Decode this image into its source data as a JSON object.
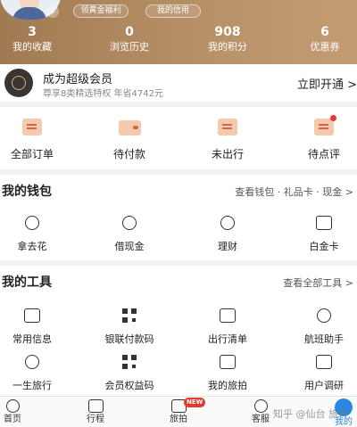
{
  "header": {
    "benefit_pill": "领黄金福利",
    "credit_pill": "我的信用",
    "stats": [
      {
        "value": "3",
        "label": "我的收藏"
      },
      {
        "value": "0",
        "label": "浏览历史"
      },
      {
        "value": "908",
        "label": "我的积分"
      },
      {
        "value": "6",
        "label": "优惠券"
      }
    ]
  },
  "vip": {
    "title": "成为超级会员",
    "subtitle": "尊享8类精选特权 年省4742元",
    "action": "立即开通 >"
  },
  "orders": {
    "items": [
      {
        "label": "全部订单",
        "icon": "order-list-icon"
      },
      {
        "label": "待付款",
        "icon": "wallet-icon"
      },
      {
        "label": "未出行",
        "icon": "clock-icon"
      },
      {
        "label": "待点评",
        "icon": "comment-icon"
      }
    ]
  },
  "wallet": {
    "title": "我的钱包",
    "link": "查看钱包 · 礼品卡 · 现金 >",
    "items": [
      {
        "label": "拿去花",
        "icon": "huabei-icon"
      },
      {
        "label": "借现金",
        "icon": "money-bag-icon"
      },
      {
        "label": "理财",
        "icon": "finance-icon"
      },
      {
        "label": "白金卡",
        "icon": "card-icon"
      }
    ]
  },
  "tools": {
    "title": "我的工具",
    "link": "查看全部工具 >",
    "items": [
      {
        "label": "常用信息",
        "icon": "id-card-icon"
      },
      {
        "label": "银联付款码",
        "icon": "barcode-icon"
      },
      {
        "label": "出行清单",
        "icon": "checklist-icon"
      },
      {
        "label": "航班助手",
        "icon": "plane-icon"
      },
      {
        "label": "一生旅行",
        "icon": "globe-icon"
      },
      {
        "label": "会员权益码",
        "icon": "qr-code-icon"
      },
      {
        "label": "我的旅拍",
        "icon": "camera-icon"
      },
      {
        "label": "用户调研",
        "icon": "survey-icon"
      }
    ]
  },
  "tabbar": {
    "items": [
      {
        "label": "首页",
        "icon": "home-icon"
      },
      {
        "label": "行程",
        "icon": "calendar-icon"
      },
      {
        "label": "旅拍",
        "icon": "video-icon"
      },
      {
        "label": "客服",
        "icon": "headset-icon"
      },
      {
        "label": "我的",
        "icon": "me-icon"
      }
    ],
    "new_badge": "NEW"
  },
  "watermark": "知乎 @仙台 旅行"
}
